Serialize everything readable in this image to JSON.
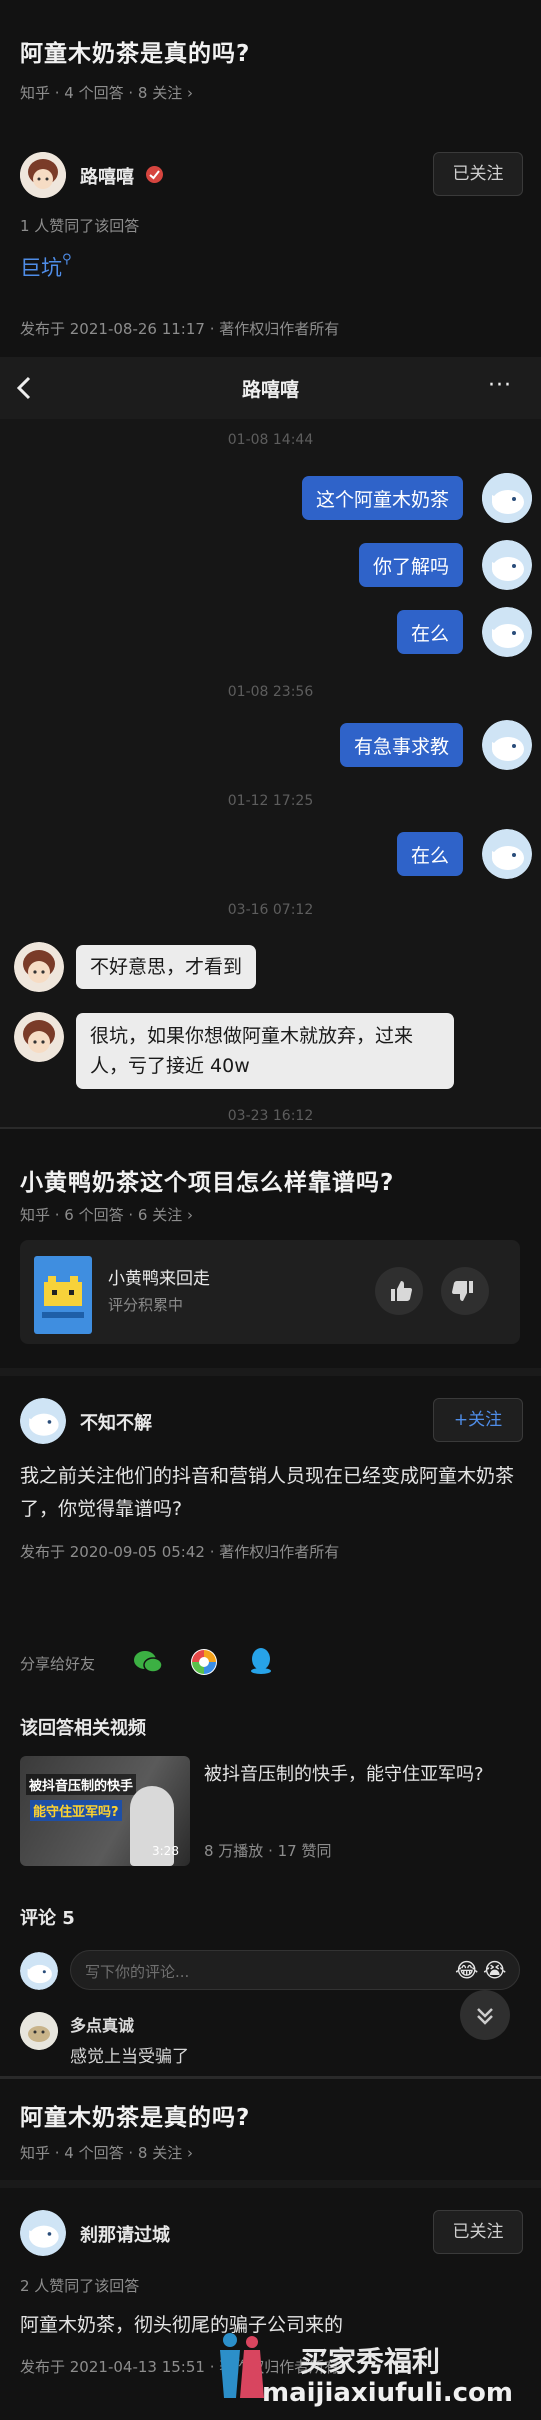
{
  "section1": {
    "question": "阿童木奶茶是真的吗?",
    "meta": "知乎 · 4 个回答 · 8 关注 ›",
    "author": "路嘻嘻",
    "follow_label": "已关注",
    "likes": "1 人赞同了该回答",
    "answer_text": "巨坑",
    "published": "发布于 2021-08-26 11:17 · 著作权归作者所有"
  },
  "chat": {
    "contact": "路嘻嘻",
    "more": "···",
    "messages": [
      {
        "time": "01-08 14:44"
      },
      {
        "side": "right",
        "text": "这个阿童木奶茶"
      },
      {
        "side": "right",
        "text": "你了解吗"
      },
      {
        "side": "right",
        "text": "在么"
      },
      {
        "time": "01-08 23:56"
      },
      {
        "side": "right",
        "text": "有急事求教"
      },
      {
        "time": "01-12 17:25"
      },
      {
        "side": "right",
        "text": "在么"
      },
      {
        "time": "03-16 07:12"
      },
      {
        "side": "left",
        "text": "不好意思，才看到"
      },
      {
        "side": "left",
        "text": "很坑，如果你想做阿童木就放弃，过来人，亏了接近 40w"
      },
      {
        "time": "03-23 16:12"
      }
    ]
  },
  "section2": {
    "question": "小黄鸭奶茶这个项目怎么样靠谱吗?",
    "meta": "知乎 · 6 个回答 · 6 关注 ›",
    "card_title": "小黄鸭来回走",
    "card_sub": "评分积累中",
    "author": "不知不解",
    "follow_label": "+关注",
    "answer_text": "我之前关注他们的抖音和营销人员现在已经变成阿童木奶茶了，你觉得靠谱吗?",
    "published": "发布于 2020-09-05 05:42 · 著作权归作者所有",
    "share_label": "分享给好友",
    "related_title": "该回答相关视频",
    "video_title": "被抖音压制的快手，能守住亚军吗?",
    "video_stats": "8 万播放 · 17 赞同",
    "video_thumb_line1": "被抖音压制的快手",
    "video_thumb_line2": "能守住亚军吗?",
    "video_duration": "3:28",
    "comments_label": "评论 5",
    "comment_placeholder": "写下你的评论...",
    "comment_author": "多点真诚",
    "comment_text": "感觉上当受骗了"
  },
  "section3": {
    "question": "阿童木奶茶是真的吗?",
    "meta": "知乎 · 4 个回答 · 8 关注 ›",
    "author": "刹那请过城",
    "follow_label": "已关注",
    "likes": "2 人赞同了该回答",
    "answer_text": "阿童木奶茶，彻头彻尾的骗子公司来的",
    "published": "发布于 2021-04-13 15:51 · 著作权归作者所有"
  },
  "watermark": {
    "line1": "买家秀福利",
    "line2": "maijiaxiufuli.com"
  },
  "colors": {
    "accent_blue": "#2f63c9",
    "background": "#121212",
    "chat_background": "#161616"
  }
}
